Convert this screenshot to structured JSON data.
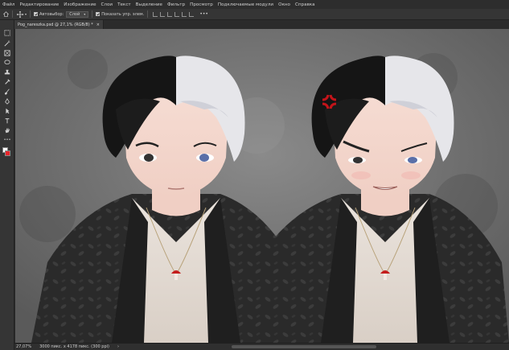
{
  "menu": [
    "Файл",
    "Редактирование",
    "Изображение",
    "Слои",
    "Текст",
    "Выделение",
    "Фильтр",
    "Просмотр",
    "Подключаемые модули",
    "Окно",
    "Справка"
  ],
  "options": {
    "autoselect_label": "Автовыбор:",
    "layer_dropdown": "Слой",
    "show_controls_label": "Показать упр. элем.",
    "more": "•••"
  },
  "document_tab": {
    "title": "Pog_nareszka.psd @ 27,1% (RGB/8) *",
    "close": "×"
  },
  "status": {
    "zoom": "27,07%",
    "doc_size": "3000 пикс. x 4178 пикс. (300 ppi)"
  },
  "colors": {
    "foreground": "#ffffff",
    "background": "#e8242a"
  },
  "tools": [
    "marquee-icon",
    "lasso-icon",
    "crop-icon",
    "frame-icon",
    "eyedropper-icon",
    "healing-icon",
    "brush-icon",
    "clone-stamp-icon",
    "history-brush-icon",
    "eraser-icon",
    "path-select-icon",
    "hand-icon",
    "more-tools-icon"
  ]
}
